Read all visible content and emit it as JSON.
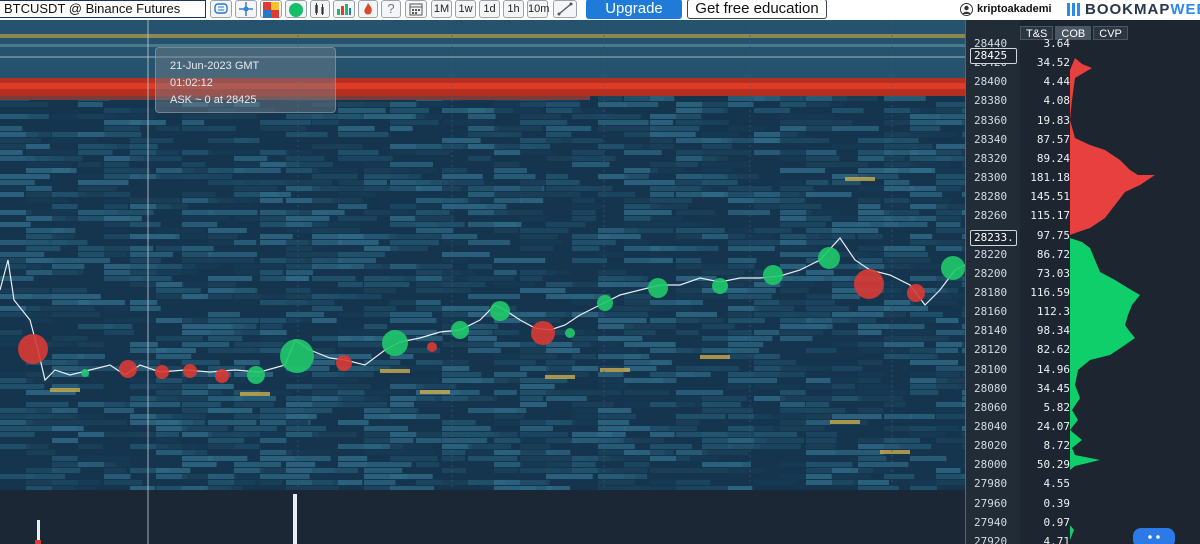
{
  "header": {
    "symbol": "BTCUSDT @ Binance Futures",
    "timeframes": [
      "1M",
      "1w",
      "1d",
      "1h",
      "10m"
    ],
    "upgrade_label": "Upgrade",
    "education_label": "Get free education",
    "username": "kriptoakademi",
    "brand_main": "BOOKMAP",
    "brand_accent": "WEB"
  },
  "tooltip": {
    "date": "21-Jun-2023 GMT",
    "time": "01:02:12",
    "info": "ASK ~ 0 at 28425"
  },
  "price_axis": {
    "labels": [
      "28440",
      "28420",
      "28400",
      "28380",
      "28360",
      "28340",
      "28320",
      "28300",
      "28280",
      "28260",
      "28240",
      "28220",
      "28200",
      "28180",
      "28160",
      "28140",
      "28120",
      "28100",
      "28080",
      "28060",
      "28040",
      "28020",
      "28000",
      "27980",
      "27960",
      "27940",
      "27920"
    ],
    "cursor_price": "28425",
    "last_price": "28233."
  },
  "cob": {
    "tabs": [
      "T&S",
      "COB",
      "CVP"
    ],
    "active_tab": "COB",
    "values": [
      "3.64",
      "34.52",
      "4.44",
      "4.08",
      "19.83",
      "87.57",
      "89.24",
      "181.18",
      "145.51",
      "115.17",
      "97.75",
      "86.72",
      "73.03",
      "116.59",
      "112.3",
      "98.34",
      "82.62",
      "14.96",
      "34.45",
      "5.82",
      "24.07",
      "8.72",
      "50.29",
      "4.55",
      "0.39",
      "0.97",
      "4.71"
    ],
    "ask_color": "#e8403e",
    "bid_color": "#0fcf6b"
  },
  "colors": {
    "heatmap_bg": "#1a3a52",
    "buy_bubble": "#1fc96a",
    "sell_bubble": "#d83a35",
    "price_line": "#e8eef4"
  }
}
